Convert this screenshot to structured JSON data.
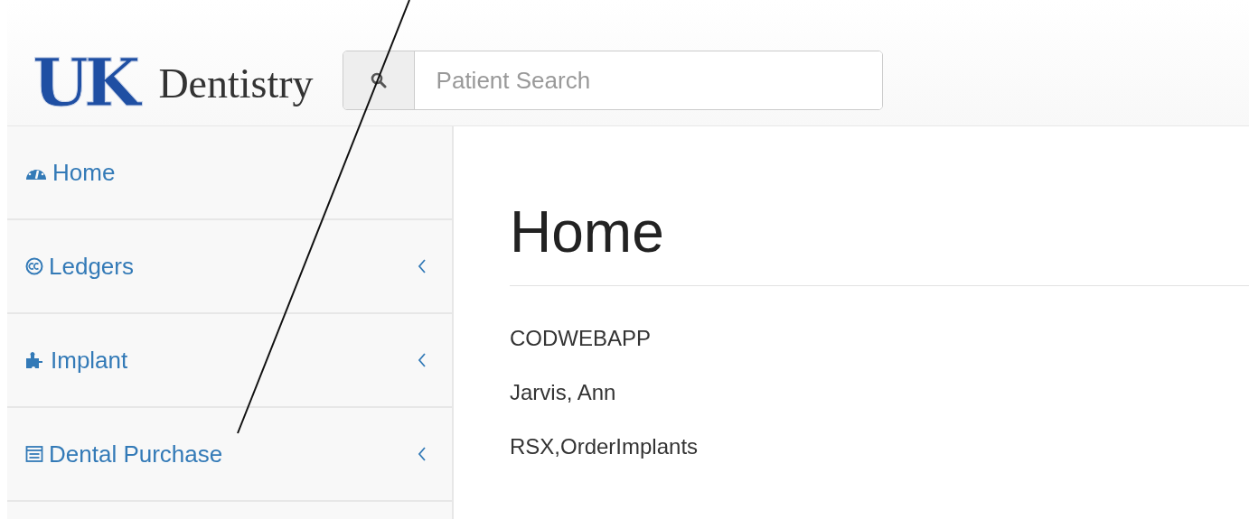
{
  "logo": {
    "mark": "UK",
    "name": "Dentistry"
  },
  "search": {
    "placeholder": "Patient Search"
  },
  "sidebar": {
    "items": [
      {
        "label": "Home",
        "expandable": false
      },
      {
        "label": "Ledgers",
        "expandable": true
      },
      {
        "label": "Implant",
        "expandable": true
      },
      {
        "label": "Dental Purchase",
        "expandable": true
      }
    ]
  },
  "content": {
    "title": "Home",
    "lines": [
      "CODWEBAPP",
      "Jarvis, Ann",
      "RSX,OrderImplants"
    ]
  }
}
